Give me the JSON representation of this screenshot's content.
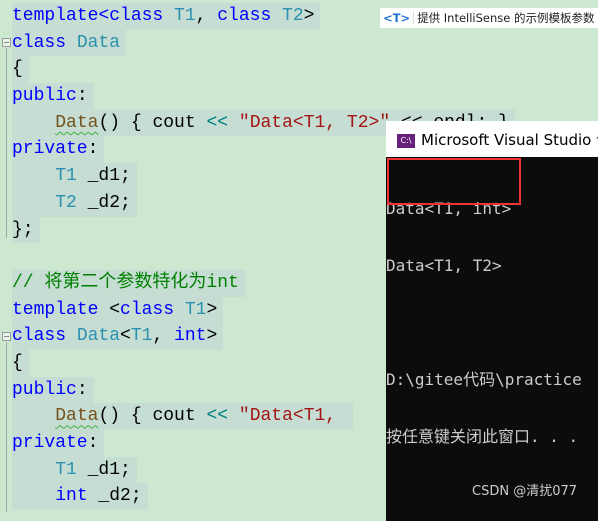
{
  "code_lines": [
    [
      [
        "kw",
        "template<class "
      ],
      [
        "ty",
        "T1"
      ],
      [
        "tx",
        ", "
      ],
      [
        "kw",
        "class "
      ],
      [
        "ty",
        "T2"
      ],
      [
        "tx",
        ">"
      ]
    ],
    [
      [
        "kw",
        "class "
      ],
      [
        "ty",
        "Data"
      ]
    ],
    [
      [
        "tx",
        "{"
      ]
    ],
    [
      [
        "kw",
        "public"
      ],
      [
        "tx",
        ":"
      ]
    ],
    [
      [
        "tx",
        "    "
      ],
      [
        "fn",
        "Data"
      ],
      [
        "tx",
        "() { cout "
      ],
      [
        "op",
        "<<"
      ],
      [
        "tx",
        " "
      ],
      [
        "st",
        "\"Data<T1, T2>\""
      ],
      [
        "tx",
        " << endl; }"
      ]
    ],
    [
      [
        "kw",
        "private"
      ],
      [
        "tx",
        ":"
      ]
    ],
    [
      [
        "tx",
        "    "
      ],
      [
        "ty",
        "T1"
      ],
      [
        "tx",
        " _d1;"
      ]
    ],
    [
      [
        "tx",
        "    "
      ],
      [
        "ty",
        "T2"
      ],
      [
        "tx",
        " _d2;"
      ]
    ],
    [
      [
        "tx",
        "};"
      ]
    ],
    [],
    [
      [
        "cm",
        "// 将第二个参数特化为int"
      ]
    ],
    [
      [
        "kw",
        "template "
      ],
      [
        "tx",
        "<"
      ],
      [
        "kw",
        "class "
      ],
      [
        "ty",
        "T1"
      ],
      [
        "tx",
        ">"
      ]
    ],
    [
      [
        "kw",
        "class "
      ],
      [
        "ty",
        "Data"
      ],
      [
        "tx",
        "<"
      ],
      [
        "ty",
        "T1"
      ],
      [
        "tx",
        ", "
      ],
      [
        "kw",
        "int"
      ],
      [
        "tx",
        ">"
      ]
    ],
    [
      [
        "tx",
        "{"
      ]
    ],
    [
      [
        "kw",
        "public"
      ],
      [
        "tx",
        ":"
      ]
    ],
    [
      [
        "tx",
        "    "
      ],
      [
        "fn",
        "Data"
      ],
      [
        "tx",
        "() { cout "
      ],
      [
        "op",
        "<<"
      ],
      [
        "tx",
        " "
      ],
      [
        "st",
        "\"Data<T1, "
      ]
    ],
    [
      [
        "kw",
        "private"
      ],
      [
        "tx",
        ":"
      ]
    ],
    [
      [
        "tx",
        "    "
      ],
      [
        "ty",
        "T1"
      ],
      [
        "tx",
        " _d1;"
      ]
    ],
    [
      [
        "tx",
        "    "
      ],
      [
        "kw",
        "int"
      ],
      [
        "tx",
        " _d2;"
      ]
    ]
  ],
  "intellisense": {
    "icon": "<T>",
    "text": "提供 IntelliSense 的示例模板参数 ▾"
  },
  "console": {
    "title": "Microsoft Visual Studio 调试控制台",
    "icon": "C:\\",
    "lines": [
      "Data<T1, int>",
      "Data<T1, T2>",
      "",
      "D:\\gitee代码\\practice",
      "按任意键关闭此窗口. . ."
    ]
  },
  "watermark": "CSDN @清扰077"
}
